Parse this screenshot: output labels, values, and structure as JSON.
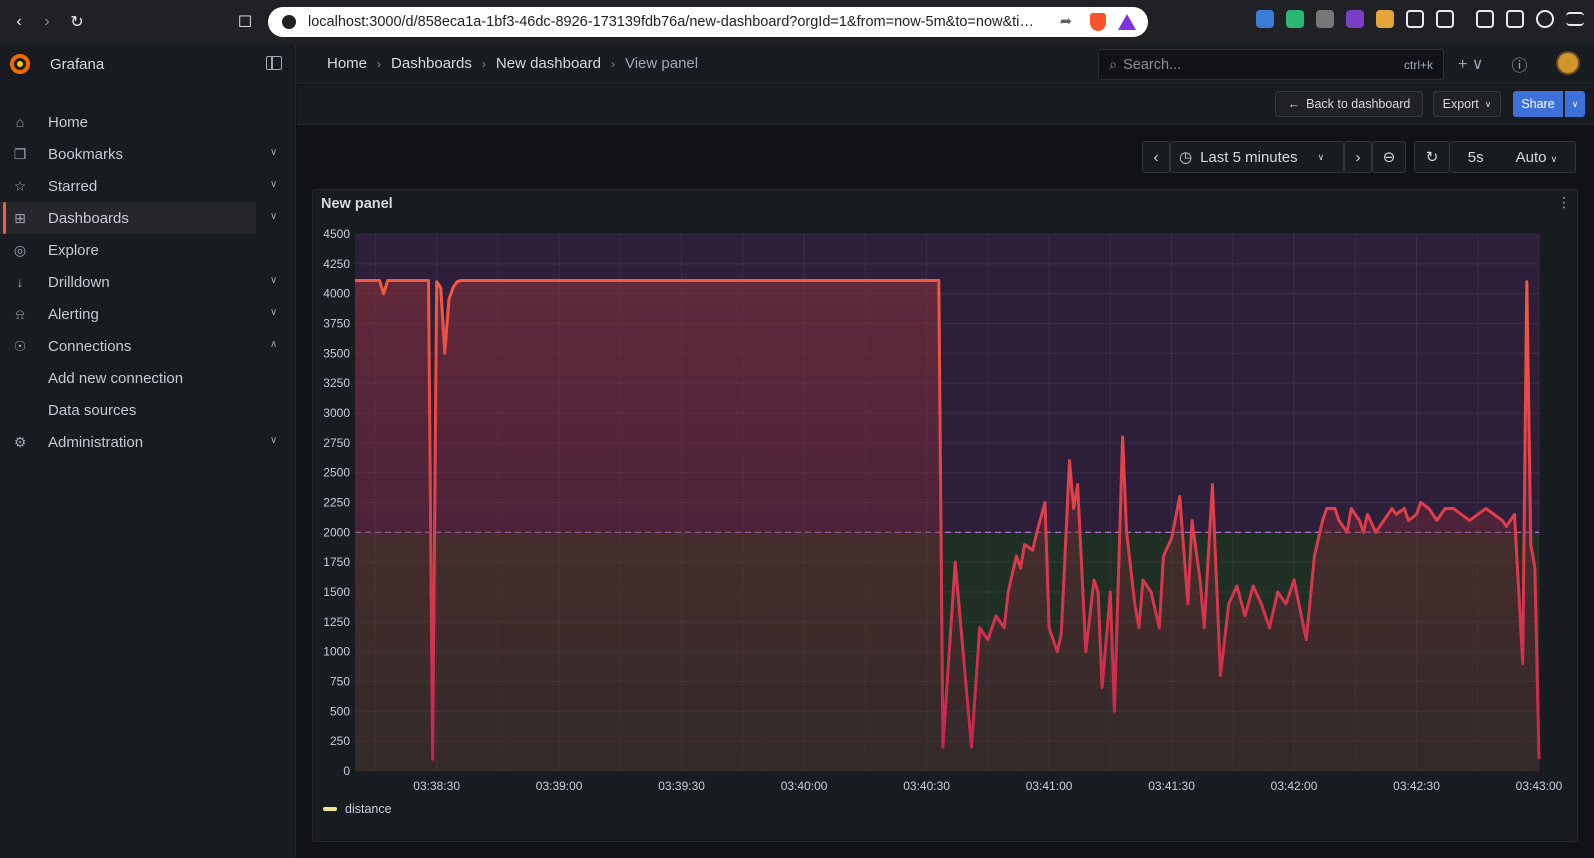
{
  "browser": {
    "url": "localhost:3000/d/858eca1a-1bf3-46dc-8926-173139fdb76a/new-dashboard?orgId=1&from=now-5m&to=now&tim..."
  },
  "app": {
    "brand": "Grafana"
  },
  "sidebar": {
    "items": [
      {
        "label": "Home",
        "icon": "home-icon"
      },
      {
        "label": "Bookmarks",
        "icon": "bookmark-icon"
      },
      {
        "label": "Starred",
        "icon": "star-icon"
      },
      {
        "label": "Dashboards",
        "icon": "dashboards-icon"
      },
      {
        "label": "Explore",
        "icon": "compass-icon"
      },
      {
        "label": "Drilldown",
        "icon": "drilldown-icon"
      },
      {
        "label": "Alerting",
        "icon": "bell-icon"
      },
      {
        "label": "Connections",
        "icon": "connections-icon"
      },
      {
        "label": "Add new connection"
      },
      {
        "label": "Data sources"
      },
      {
        "label": "Administration",
        "icon": "gear-icon"
      }
    ]
  },
  "breadcrumb": [
    "Home",
    "Dashboards",
    "New dashboard",
    "View panel"
  ],
  "search": {
    "placeholder": "Search...",
    "shortcut": "ctrl+k"
  },
  "actions": {
    "back": "Back to dashboard",
    "export": "Export",
    "share": "Share"
  },
  "time": {
    "range": "Last 5 minutes",
    "refresh": "5s",
    "mode": "Auto"
  },
  "panel": {
    "title": "New panel"
  },
  "chart_data": {
    "type": "area",
    "title": "New panel",
    "ylim": [
      0,
      4500
    ],
    "yticks": [
      0,
      250,
      500,
      750,
      1000,
      1250,
      1500,
      1750,
      2000,
      2250,
      2500,
      2750,
      3000,
      3250,
      3500,
      3750,
      4000,
      4250,
      4500
    ],
    "xticks": [
      "03:38:30",
      "03:39:00",
      "03:39:30",
      "03:40:00",
      "03:40:30",
      "03:41:00",
      "03:41:30",
      "03:42:00",
      "03:42:30",
      "03:43:00"
    ],
    "threshold": 2000,
    "colors": {
      "line_high": "#f2593e",
      "line_low": "#c8244f",
      "zone_high": "#2d1f3a",
      "zone_low": "#1f2f24"
    },
    "series": [
      {
        "name": "distance",
        "x": [
          "03:38:10",
          "03:38:16",
          "03:38:17",
          "03:38:18",
          "03:38:28",
          "03:38:29",
          "03:38:30",
          "03:38:31",
          "03:38:32",
          "03:38:33",
          "03:38:34",
          "03:38:35",
          "03:38:36",
          "03:38:37",
          "03:38:38",
          "03:38:39",
          "03:38:40",
          "03:39:00",
          "03:39:30",
          "03:40:00",
          "03:40:30",
          "03:40:33",
          "03:40:34",
          "03:40:37",
          "03:40:41",
          "03:40:43",
          "03:40:45",
          "03:40:47",
          "03:40:49",
          "03:40:50",
          "03:40:52",
          "03:40:53",
          "03:40:54",
          "03:40:56",
          "03:40:57",
          "03:40:59",
          "03:41:00",
          "03:41:01",
          "03:41:02",
          "03:41:03",
          "03:41:05",
          "03:41:06",
          "03:41:07",
          "03:41:09",
          "03:41:11",
          "03:41:12",
          "03:41:13",
          "03:41:15",
          "03:41:16",
          "03:41:18",
          "03:41:19",
          "03:41:21",
          "03:41:22",
          "03:41:23",
          "03:41:25",
          "03:41:27",
          "03:41:28",
          "03:41:30",
          "03:41:32",
          "03:41:34",
          "03:41:35",
          "03:41:37",
          "03:41:38",
          "03:41:40",
          "03:41:42",
          "03:41:44",
          "03:41:46",
          "03:41:48",
          "03:41:50",
          "03:41:52",
          "03:41:54",
          "03:41:56",
          "03:41:58",
          "03:42:00",
          "03:42:03",
          "03:42:05",
          "03:42:07",
          "03:42:08",
          "03:42:10",
          "03:42:11",
          "03:42:13",
          "03:42:14",
          "03:42:16",
          "03:42:17",
          "03:42:18",
          "03:42:20",
          "03:42:22",
          "03:42:24",
          "03:42:25",
          "03:42:27",
          "03:42:28",
          "03:42:30",
          "03:42:31",
          "03:42:33",
          "03:42:35",
          "03:42:37",
          "03:42:39",
          "03:42:41",
          "03:42:43",
          "03:42:45",
          "03:42:47",
          "03:42:49",
          "03:42:51",
          "03:42:52",
          "03:42:54",
          "03:42:56",
          "03:42:57",
          "03:42:58",
          "03:42:59",
          "03:43:00"
        ],
        "values": [
          4110,
          4110,
          4000,
          4110,
          4110,
          100,
          4100,
          4050,
          3500,
          3950,
          4050,
          4100,
          4110,
          4110,
          4110,
          4110,
          4110,
          4110,
          4110,
          4110,
          4110,
          4110,
          200,
          1750,
          200,
          1200,
          1100,
          1300,
          1200,
          1500,
          1800,
          1700,
          1900,
          1850,
          2000,
          2250,
          1200,
          1100,
          1000,
          1150,
          2600,
          2200,
          2400,
          1000,
          1600,
          1500,
          700,
          1500,
          500,
          2800,
          2000,
          1400,
          1200,
          1600,
          1500,
          1200,
          1800,
          1950,
          2300,
          1400,
          2100,
          1600,
          1200,
          2400,
          800,
          1400,
          1550,
          1300,
          1550,
          1400,
          1200,
          1500,
          1400,
          1600,
          1100,
          1800,
          2100,
          2200,
          2200,
          2100,
          2000,
          2200,
          2100,
          2000,
          2150,
          2000,
          2100,
          2200,
          2150,
          2200,
          2100,
          2150,
          2250,
          2200,
          2100,
          2200,
          2200,
          2150,
          2100,
          2150,
          2200,
          2150,
          2100,
          2050,
          2150,
          900,
          4100,
          1900,
          1700,
          100
        ]
      }
    ]
  }
}
